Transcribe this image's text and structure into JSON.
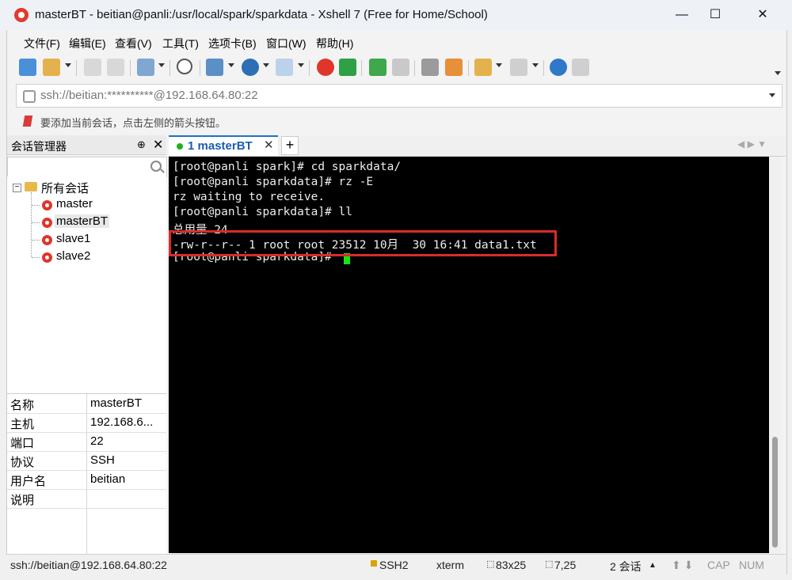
{
  "window": {
    "title": "masterBT - beitian@panli:/usr/local/spark/sparkdata - Xshell 7 (Free for Home/School)",
    "minimize_label": "—",
    "maximize_label": "☐",
    "close_label": "✕"
  },
  "menu": [
    "文件(F)",
    "编辑(E)",
    "查看(V)",
    "工具(T)",
    "选项卡(B)",
    "窗口(W)",
    "帮助(H)"
  ],
  "toolbar": {
    "icons": [
      "new-session-icon",
      "open-folder-icon",
      "reconnect-icon",
      "disconnect-icon",
      "properties-icon",
      "find-icon",
      "transfer-icon",
      "globe-icon",
      "font-icon",
      "xshell-icon",
      "xftp-icon",
      "fullscreen-icon",
      "lock-icon",
      "keyboard-icon",
      "highlight-pen-icon",
      "add-compose-icon",
      "layout-icon",
      "help-icon",
      "chat-icon"
    ]
  },
  "address": {
    "value": "ssh://beitian:**********@192.168.64.80:22"
  },
  "hint": {
    "text": "要添加当前会话，点击左侧的箭头按钮。"
  },
  "session_manager": {
    "title": "会话管理器",
    "pin": "⊕",
    "close": "✕",
    "search_placeholder": "",
    "root_label": "所有会话",
    "root_expander": "−",
    "sessions": [
      "master",
      "masterBT",
      "slave1",
      "slave2"
    ]
  },
  "properties": [
    {
      "key": "名称",
      "value": "masterBT"
    },
    {
      "key": "主机",
      "value": "192.168.6..."
    },
    {
      "key": "端口",
      "value": "22"
    },
    {
      "key": "协议",
      "value": "SSH"
    },
    {
      "key": "用户名",
      "value": "beitian"
    },
    {
      "key": "说明",
      "value": ""
    }
  ],
  "tabs": {
    "active_label": "1 masterBT",
    "close": "✕",
    "add": "+",
    "nav": "◀ ▶  ▼"
  },
  "terminal": {
    "lines": [
      "[root@panli spark]# cd sparkdata/",
      "[root@panli sparkdata]# rz -E",
      "rz waiting to receive.",
      "[root@panli sparkdata]# ll",
      "总用量 24",
      "-rw-r--r-- 1 root root 23512 10月  30 16:41 data1.txt",
      "[root@panli sparkdata]# "
    ],
    "colors": {
      "background": "#000000",
      "text": "#ededed",
      "cursor": "#14e614",
      "highlight_box": "#d92b2b"
    }
  },
  "status": {
    "connection": "ssh://beitian@192.168.64.80:22",
    "protocol": "SSH2",
    "terminal_type": "xterm",
    "size": "83x25",
    "cursor_pos": "7,25",
    "sessions": "2 会话",
    "sessions_arrow": "▲",
    "arrows": "⬆ ⬇",
    "caps": "CAP",
    "num": "NUM"
  }
}
